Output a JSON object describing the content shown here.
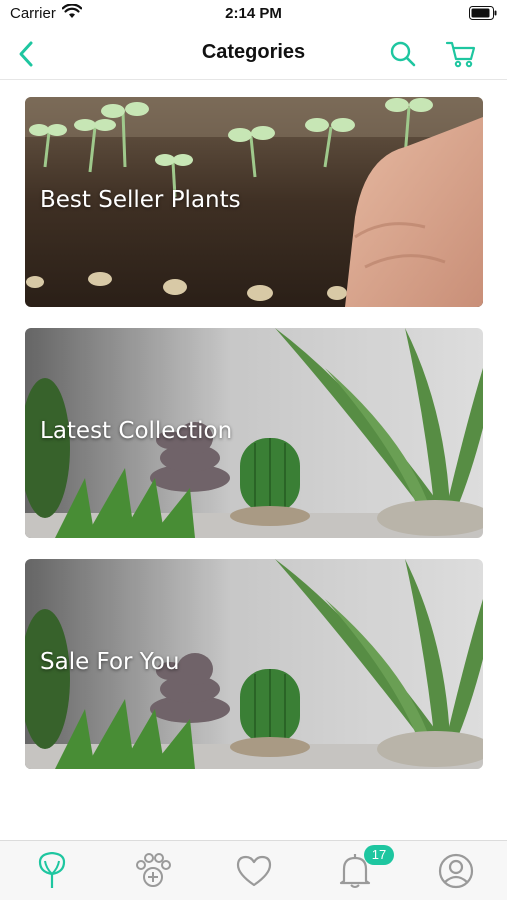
{
  "status_bar": {
    "carrier": "Carrier",
    "time": "2:14 PM"
  },
  "header": {
    "title": "Categories"
  },
  "categories": [
    {
      "label": "Best Seller Plants"
    },
    {
      "label": "Latest Collection"
    },
    {
      "label": "Sale For You"
    }
  ],
  "tab_bar": {
    "notification_badge": "17"
  },
  "colors": {
    "accent": "#1ec6a0",
    "icon_gray": "#9a9a9a"
  }
}
